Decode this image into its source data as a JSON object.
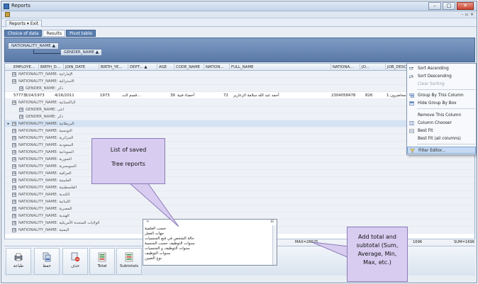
{
  "window": {
    "title": "Reports",
    "doc_tab": "Reports ▾ Exit",
    "mdi_controls": [
      "-",
      "▫",
      "×"
    ]
  },
  "subtabs": [
    "Choice of data",
    "Results",
    "Pivot table"
  ],
  "group_panel": {
    "chip1": "NATIONALITY_NAME ▲",
    "chip2": "GENDER_NAME ▲"
  },
  "grid": {
    "columns": [
      "EMPLOYE...",
      "BIRTH_D...",
      "JOIN_DATE",
      "BIRTH_YE...",
      "DEPT... ▲",
      "AGE",
      "CODE_NAME",
      "NATION...",
      "FULL_NAME",
      "NATIONA...",
      "JO...",
      "JOB_DESC"
    ],
    "rows": [
      {
        "type": "group",
        "label": "NATIONALITY_NAME: الإماراتية"
      },
      {
        "type": "group",
        "label": "NATIONALITY_NAME: الاسترالية"
      },
      {
        "type": "subgroup",
        "label": "GENDER_NAME: ذكر"
      },
      {
        "type": "data",
        "cells": [
          "57773",
          "3/24/1973",
          "4/16/2011",
          "1973",
          "قسم الت...",
          "39",
          "أخصاء فنية",
          "72",
          "أحمد عبد الله سلامة الزعارير",
          "2304058478",
          "826",
          "1 محاضرون"
        ]
      },
      {
        "type": "group",
        "label": "NATIONALITY_NAME: الباكستانية"
      },
      {
        "type": "subgroup",
        "label": "GENDER_NAME: انثى"
      },
      {
        "type": "subgroup",
        "label": "GENDER_NAME: ذكر"
      },
      {
        "type": "group",
        "label": "NATIONALITY_NAME: البريطانية",
        "active": true
      },
      {
        "type": "group",
        "label": "NATIONALITY_NAME: التونسية"
      },
      {
        "type": "group",
        "label": "NATIONALITY_NAME: الجزائرية"
      },
      {
        "type": "group",
        "label": "NATIONALITY_NAME: السعودية"
      },
      {
        "type": "group",
        "label": "NATIONALITY_NAME: السودانية"
      },
      {
        "type": "group",
        "label": "NATIONALITY_NAME: السورية"
      },
      {
        "type": "group",
        "label": "NATIONALITY_NAME: السويسرية"
      },
      {
        "type": "group",
        "label": "NATIONALITY_NAME: العراقية"
      },
      {
        "type": "group",
        "label": "NATIONALITY_NAME: الفلبينية"
      },
      {
        "type": "group",
        "label": "NATIONALITY_NAME: الفلسطينية"
      },
      {
        "type": "group",
        "label": "NATIONALITY_NAME: الكندية"
      },
      {
        "type": "group",
        "label": "NATIONALITY_NAME: اللبنانية"
      },
      {
        "type": "group",
        "label": "NATIONALITY_NAME: المصرية"
      },
      {
        "type": "group",
        "label": "NATIONALITY_NAME: الهندية"
      },
      {
        "type": "group",
        "label": "NATIONALITY_NAME: الولايات المتحدة الأمريكية"
      },
      {
        "type": "group",
        "label": "NATIONALITY_NAME: اليمنية"
      }
    ]
  },
  "summary": {
    "max": "MAX=28625",
    "val": "1696",
    "sum": "SUM=1696"
  },
  "context_menu": {
    "items": [
      {
        "label": "Sort Ascending",
        "icon": "sort-asc-icon"
      },
      {
        "label": "Sort Descending",
        "icon": "sort-desc-icon"
      },
      {
        "label": "Clear Sorting",
        "icon": "",
        "disabled": true
      },
      {
        "label": "Group By This Column",
        "icon": "group-icon"
      },
      {
        "label": "Hide Group By Box",
        "icon": "groupbox-icon"
      },
      {
        "label": "Remove This Column",
        "icon": ""
      },
      {
        "label": "Column Chooser",
        "icon": "columns-icon"
      },
      {
        "label": "Best Fit",
        "icon": "bestfit-icon"
      },
      {
        "label": "Best Fit (all columns)",
        "icon": ""
      },
      {
        "label": "Filter Editor...",
        "icon": "filter-icon",
        "highlight": true
      }
    ]
  },
  "saved_reports": {
    "items": [
      "حسب العلمية",
      "جهات العمل",
      "حالة الشخص في قبع الجنسيات",
      "سنوات التوظيف حسب الجنسية",
      "سنوات التوظيف و الجنسيات",
      "سنوات التوظيف",
      "نوع التعيين"
    ]
  },
  "bottom_toolbar": {
    "buttons": [
      "طباعة",
      "حفظ",
      "حذف",
      "Total",
      "Subtotals"
    ]
  },
  "callouts": {
    "saved": [
      "List of saved",
      "Tree reports"
    ],
    "totals": [
      "Add total and",
      "subtotal (Sum,",
      "Average, Min,",
      "Max, etc.)"
    ]
  }
}
